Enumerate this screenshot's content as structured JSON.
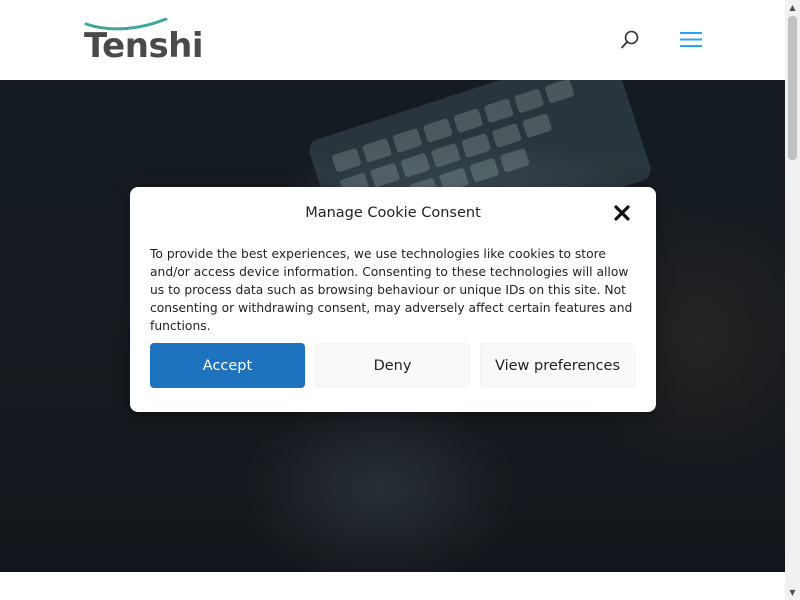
{
  "header": {
    "logo_text": "Tenshi",
    "logo_swoosh_color": "#3fa79a",
    "icons": {
      "search": "search-icon",
      "menu": "hamburger-menu-icon"
    },
    "accent_color": "#2ea3f2"
  },
  "cookie_dialog": {
    "title": "Manage Cookie Consent",
    "body": "To provide the best experiences, we use technologies like cookies to store and/or access device information. Consenting to these technologies will allow us to process data such as browsing behaviour or unique IDs on this site. Not consenting or withdrawing consent, may adversely affect certain features and functions.",
    "buttons": {
      "accept": "Accept",
      "deny": "Deny",
      "preferences": "View preferences"
    },
    "close_icon": "close-icon",
    "accept_color": "#1e73be"
  },
  "scrollbar": {
    "up_arrow": "▲",
    "down_arrow": "▼"
  }
}
